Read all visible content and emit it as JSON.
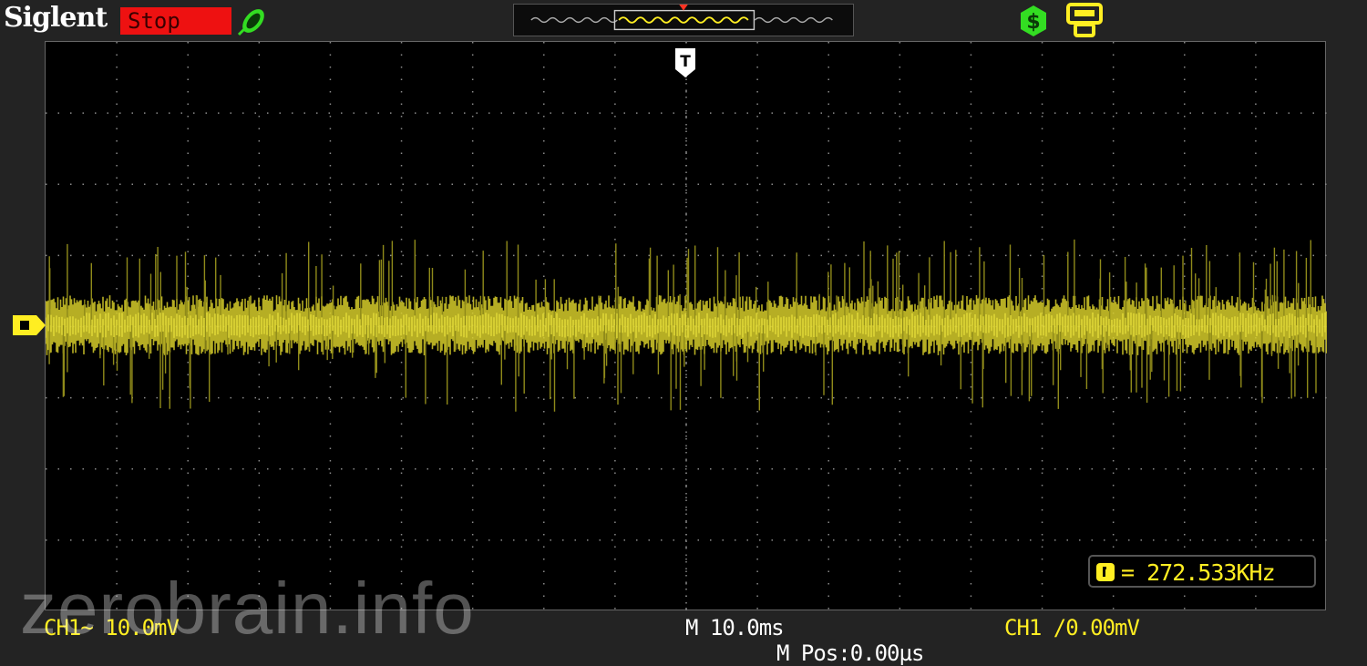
{
  "header": {
    "brand": "Siglent",
    "status": "Stop",
    "icons": {
      "probe": "probe-icon",
      "dollar": "dollar-icon",
      "usb": "usb-icon"
    }
  },
  "display": {
    "trigger_marker": "T",
    "frequency": "= 272.533KHz"
  },
  "footer": {
    "ch1_scale": "CH1~ 10.0mV",
    "timebase": "M 10.0ms",
    "mpos": "M Pos:0.00µs",
    "trigger": "CH1 /0.00mV"
  },
  "watermark": "zerobrain.info",
  "colors": {
    "trace": "#d6cc2a",
    "trace_dark": "#8f8a1a",
    "status_bg": "#ee1111",
    "grid": "#8a8a8a",
    "accent_green": "#33dd22"
  }
}
